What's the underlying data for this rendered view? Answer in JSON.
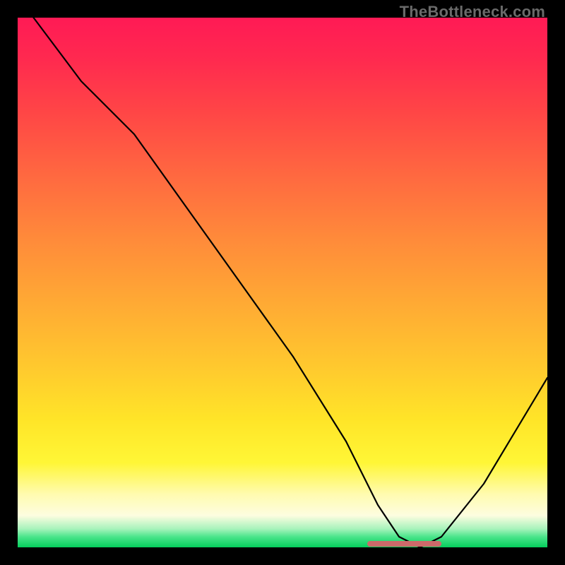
{
  "watermark": "TheBottleneck.com",
  "chart_data": {
    "type": "line",
    "title": "",
    "xlabel": "",
    "ylabel": "",
    "xlim": [
      0,
      100
    ],
    "ylim": [
      0,
      100
    ],
    "x": [
      3,
      12,
      22,
      32,
      42,
      52,
      62,
      68,
      72,
      76,
      80,
      88,
      100
    ],
    "values": [
      100,
      88,
      78,
      64,
      50,
      36,
      20,
      8,
      2,
      0,
      2,
      12,
      32
    ],
    "optimal_range_x": [
      66,
      80
    ],
    "optimal_bar_color": "#cc6a6a",
    "curve_color": "#000000"
  }
}
